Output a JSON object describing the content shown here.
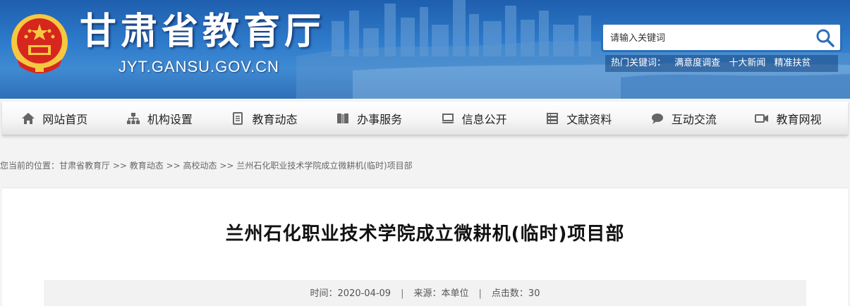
{
  "header": {
    "title": "甘肃省教育厅",
    "domain": "JYT.GANSU.GOV.CN",
    "search_placeholder": "请输入关键词",
    "hotwords_label": "热门关键词：",
    "hotwords": [
      "满意度调查",
      "十大新闻",
      "精准扶贫"
    ]
  },
  "nav": {
    "items": [
      {
        "label": "网站首页",
        "icon": "home-icon"
      },
      {
        "label": "机构设置",
        "icon": "sitemap-icon"
      },
      {
        "label": "教育动态",
        "icon": "document-icon"
      },
      {
        "label": "办事服务",
        "icon": "book-icon"
      },
      {
        "label": "信息公开",
        "icon": "laptop-icon"
      },
      {
        "label": "文献资料",
        "icon": "list-icon"
      },
      {
        "label": "互动交流",
        "icon": "chat-icon"
      },
      {
        "label": "教育网视",
        "icon": "video-icon"
      }
    ]
  },
  "breadcrumb": {
    "prefix": "您当前的位置：",
    "items": [
      "甘肃省教育厅",
      "教育动态",
      "高校动态",
      "兰州石化职业技术学院成立微耕机(临时)项目部"
    ],
    "separator": " >> "
  },
  "article": {
    "title": "兰州石化职业技术学院成立微耕机(临时)项目部",
    "date_label": "时间：",
    "date": "2020-04-09",
    "source_label": "来源：",
    "source": "本单位",
    "clicks_label": "点击数：",
    "clicks": "30",
    "meta_separator": "|"
  },
  "colors": {
    "header_blue": "#2f7ccc",
    "emblem_red": "#d7261e",
    "emblem_gold": "#f5c842"
  }
}
